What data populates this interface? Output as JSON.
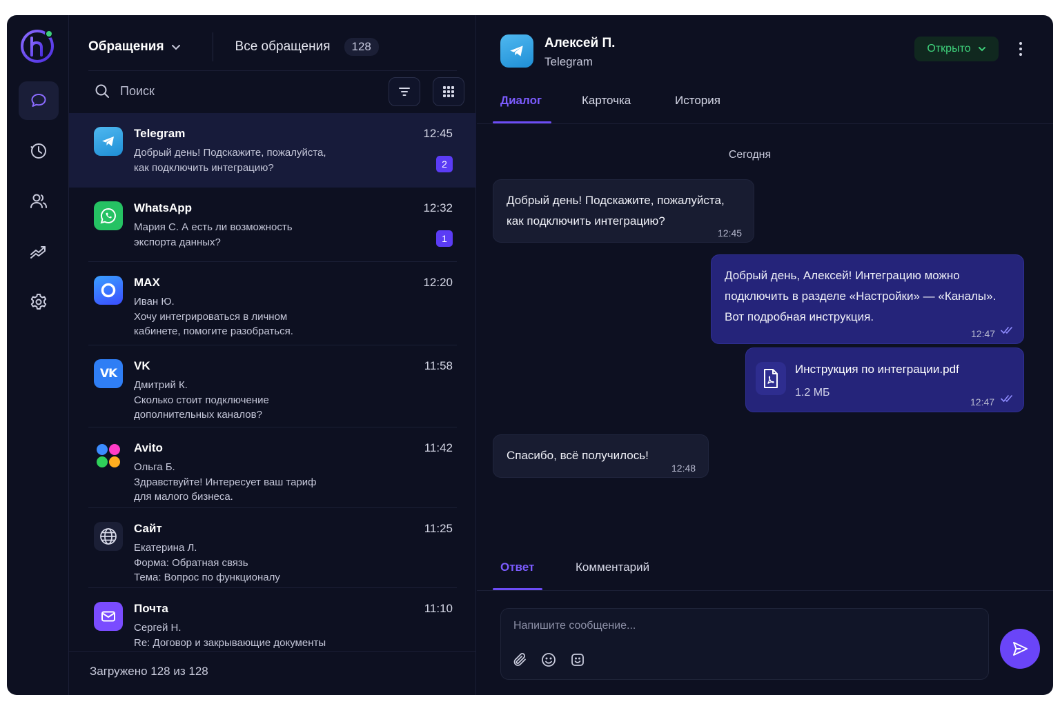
{
  "app": {
    "name": "h"
  },
  "nav": {
    "items": [
      {
        "icon": "chat-icon",
        "active": true
      },
      {
        "icon": "clock-icon",
        "active": false
      },
      {
        "icon": "users-icon",
        "active": false
      },
      {
        "icon": "analytics-icon",
        "active": false
      },
      {
        "icon": "gear-icon",
        "active": false
      }
    ]
  },
  "list": {
    "title": "Обращения",
    "all_label": "Все обращения",
    "total": "128",
    "search_placeholder": "Поиск",
    "footer": "Загружено 128 из 128",
    "conversations": [
      {
        "channel": "Telegram",
        "icon": "telegram-icon",
        "time": "12:45",
        "lines": [
          "Добрый день! Подскажите, пожалуйста,",
          "как подключить интеграцию?"
        ],
        "unread": "2",
        "active": true
      },
      {
        "channel": "WhatsApp",
        "icon": "whatsapp-icon",
        "time": "12:32",
        "lines": [
          "Мария С. А есть ли возможность",
          "экспорта данных?"
        ],
        "unread": "1"
      },
      {
        "channel": "MAX",
        "icon": "max-icon",
        "time": "12:20",
        "lines": [
          "Иван Ю.",
          "Хочу интегрироваться в личном",
          "кабинете, помогите разобраться."
        ]
      },
      {
        "channel": "VK",
        "icon": "vk-icon",
        "time": "11:58",
        "lines": [
          "Дмитрий К.",
          "Сколько стоит подключение",
          "дополнительных каналов?"
        ]
      },
      {
        "channel": "Avito",
        "icon": "avito-icon",
        "time": "11:42",
        "lines": [
          "Ольга Б.",
          "Здравствуйте! Интересует ваш тариф",
          "для малого бизнеса."
        ]
      },
      {
        "channel": "Сайт",
        "icon": "globe-icon",
        "time": "11:25",
        "lines": [
          "Екатерина Л.",
          "Форма: Обратная связь",
          "Тема: Вопрос по функционалу"
        ]
      },
      {
        "channel": "Почта",
        "icon": "mail-icon",
        "time": "11:10",
        "lines": [
          "Сергей Н.",
          "Re: Договор и закрывающие документы"
        ]
      }
    ]
  },
  "chat": {
    "contact_name": "Алексей П.",
    "contact_channel": "Telegram",
    "status": "Открыто",
    "tabs": [
      "Диалог",
      "Карточка",
      "История"
    ],
    "day": "Сегодня",
    "messages": [
      {
        "dir": "in",
        "lines": [
          "Добрый день! Подскажите, пожалуйста,",
          "как подключить интеграцию?"
        ],
        "time": "12:45"
      },
      {
        "dir": "out",
        "lines": [
          "Добрый день, Алексей! Интеграцию можно",
          "подключить в разделе «Настройки» — «Каналы».",
          "Вот подробная инструкция."
        ],
        "time": "12:47"
      },
      {
        "dir": "out",
        "file": {
          "name": "Инструкция по интеграции.pdf",
          "size": "1.2 МБ"
        },
        "time": "12:47"
      },
      {
        "dir": "in",
        "lines": [
          "Спасибо, всё получилось!"
        ],
        "time": "12:48"
      }
    ],
    "reply_tabs": [
      "Ответ",
      "Комментарий"
    ],
    "composer_placeholder": "Напишите сообщение..."
  },
  "colors": {
    "accent": "#6a45f8",
    "status_green": "#3ed17b",
    "background": "#0d1021"
  }
}
